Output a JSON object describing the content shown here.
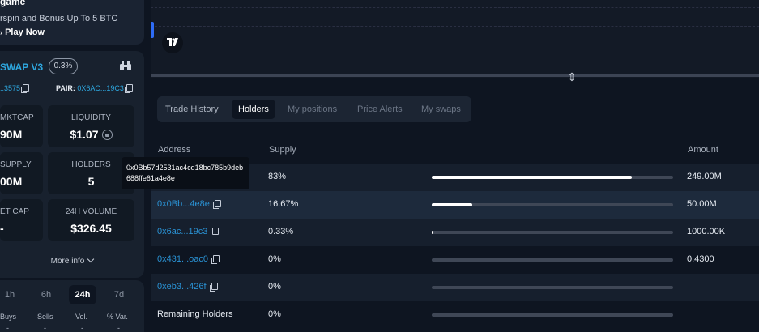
{
  "promo": {
    "title": "game",
    "body": "rspin and Bonus Up To 5 BTC",
    "cta": "Play Now"
  },
  "pair_card": {
    "dex": "SWAP V3",
    "fee": "0.3%",
    "token_address": "..3575",
    "pair_label": "PAIR:",
    "pair_address": "0X6AC...19C3",
    "stats": {
      "mktcap": {
        "label": "MKTCAP",
        "value": "90M"
      },
      "liquidity": {
        "label": "LIQUIDITY",
        "value": "$1.07"
      },
      "supply": {
        "label": "SUPPLY",
        "value": "00M"
      },
      "holders": {
        "label": "HOLDERS",
        "value": "5"
      },
      "netcap": {
        "label": "ET CAP",
        "value": "-"
      },
      "volume": {
        "label": "24H VOLUME",
        "value": "$326.45"
      }
    },
    "more_info": "More info"
  },
  "timeframes": {
    "items": [
      "1h",
      "6h",
      "24h",
      "7d"
    ],
    "active": "24h",
    "headers": [
      "Buys",
      "Sells",
      "Vol.",
      "% Var."
    ],
    "values": [
      "-",
      "-",
      "-",
      "-"
    ]
  },
  "chart": {
    "logo": "TV"
  },
  "tabs": {
    "items": [
      "Trade History",
      "Holders",
      "My positions",
      "Price Alerts",
      "My swaps"
    ],
    "active": "Holders"
  },
  "holders_table": {
    "headers": {
      "address": "Address",
      "supply": "Supply",
      "amount": "Amount"
    },
    "rows": [
      {
        "address": "",
        "supply": "83%",
        "amount": "249.00M",
        "pct": 0.83
      },
      {
        "address": "0x0Bb...4e8e",
        "supply": "16.67%",
        "amount": "50.00M",
        "pct": 0.1667
      },
      {
        "address": "0x6ac...19c3",
        "supply": "0.33%",
        "amount": "1000.00K",
        "pct": 0.0033
      },
      {
        "address": "0x431...oac0",
        "supply": "0%",
        "amount": "0.4300",
        "pct": 0
      },
      {
        "address": "0xeb3...426f",
        "supply": "0%",
        "amount": "",
        "pct": 0
      },
      {
        "address": "Remaining Holders",
        "supply": "0%",
        "amount": "",
        "pct": 0
      }
    ],
    "tooltip": "0x0Bb57d2531ac4cd18bc785b9deb688ffe61a4e8e"
  },
  "colors": {
    "accent": "#2ea8e0",
    "background": "#0e1521",
    "panel": "#18212e"
  }
}
